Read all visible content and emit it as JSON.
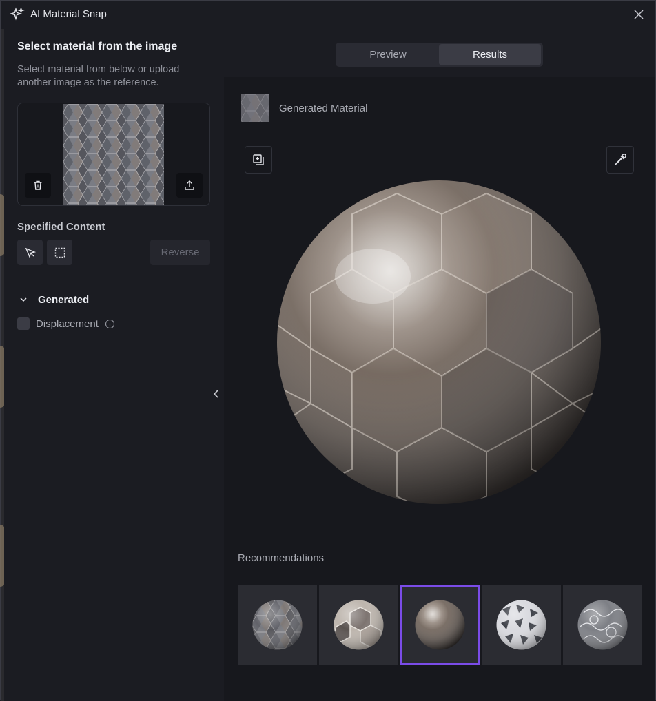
{
  "window": {
    "title": "AI Material Snap"
  },
  "left": {
    "heading": "Select material from the image",
    "hint": "Select material from below or upload another image as the reference.",
    "specified_heading": "Specified Content",
    "reverse_label": "Reverse",
    "generated_label": "Generated",
    "displacement_label": "Displacement"
  },
  "tabs": {
    "preview": "Preview",
    "results": "Results",
    "active": "Results"
  },
  "right": {
    "generated_label": "Generated Material",
    "recommendations_label": "Recommendations",
    "selected_recommendation_index": 2
  },
  "colors": {
    "accent": "#7b4ce8",
    "active_tab": "#3b3c45"
  },
  "icons": [
    "sparkle-icon",
    "close-icon",
    "trash-icon",
    "upload-icon",
    "cursor-icon",
    "marquee-select-icon",
    "chevron-down-icon",
    "info-icon",
    "chevron-left-icon",
    "add-to-library-icon",
    "eyedropper-icon"
  ]
}
